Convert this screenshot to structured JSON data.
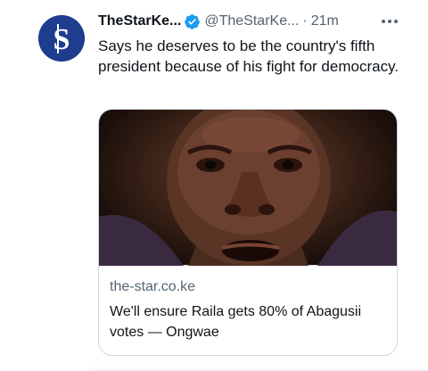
{
  "account": {
    "name": "TheStarKe...",
    "handle": "@TheStarKe...",
    "separator": "·",
    "time": "21m",
    "avatar_letter": "S",
    "avatar_color": "#1e3d8f",
    "verified_icon": "verified-badge-icon"
  },
  "tweet": {
    "text": "Says he deserves to be the country's fifth president because of his fight for democracy."
  },
  "card": {
    "domain": "the-star.co.ke",
    "title": "We'll ensure Raila gets 80% of Abagusii votes — Ongwae",
    "image_description_icon": "news-photo"
  },
  "colors": {
    "text_primary": "#0f1419",
    "text_secondary": "#536471",
    "verified_blue": "#1d9bf0",
    "border": "#cfd9de"
  }
}
